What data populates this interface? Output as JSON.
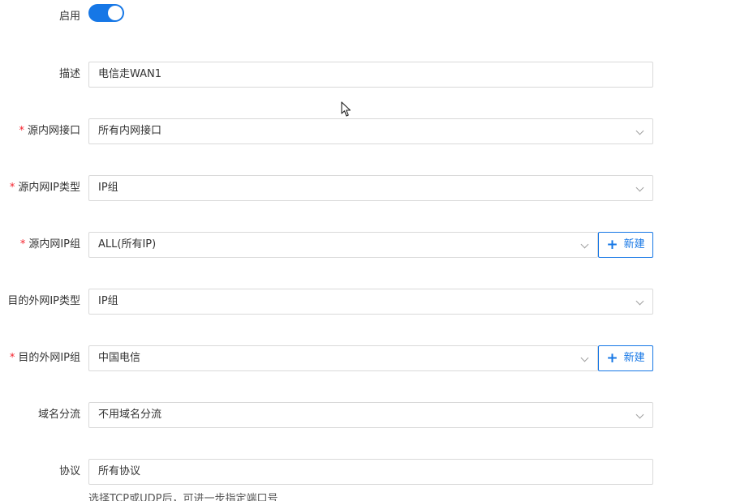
{
  "form": {
    "enable": {
      "label": "启用",
      "on": true
    },
    "description": {
      "label": "描述",
      "value": "电信走WAN1"
    },
    "src_interface": {
      "label": "源内网接口",
      "required": true,
      "value": "所有内网接口"
    },
    "src_ip_type": {
      "label": "源内网IP类型",
      "required": true,
      "value": "IP组"
    },
    "src_ip_group": {
      "label": "源内网IP组",
      "required": true,
      "value": "ALL(所有IP)",
      "new_label": "新建"
    },
    "dst_ip_type": {
      "label": "目的外网IP类型",
      "required": true,
      "value": "IP组"
    },
    "dst_ip_group": {
      "label": "目的外网IP组",
      "required": true,
      "value": "中国电信",
      "new_label": "新建"
    },
    "domain_split": {
      "label": "域名分流",
      "value": "不用域名分流"
    },
    "protocol": {
      "label": "协议",
      "value": "所有协议",
      "hint": "选择TCP或UDP后，可进一步指定端口号"
    }
  },
  "colors": {
    "primary": "#1677e6",
    "required": "#f5222d",
    "border": "#d9d9d9"
  },
  "icons": {
    "chevron": "chevron-down-icon",
    "plus": "plus-icon",
    "cursor": "mouse-cursor-icon"
  }
}
